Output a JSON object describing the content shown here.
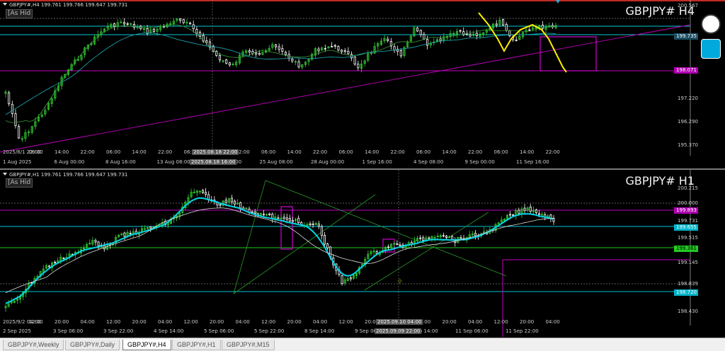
{
  "top": {
    "symbol_line": "GBPJPY#,H4  199.761 199.766 199.647 199.731",
    "as_hide": "[As Hid",
    "big_label": "GBPJPY#  H4",
    "price_labels": [
      "200.567",
      "198.150",
      "197.220",
      "196.290",
      "195.370"
    ],
    "tags": [
      {
        "text": "199.735",
        "bg": "#1b4f64",
        "fg": "#ffffff"
      },
      {
        "text": "198.071",
        "bg": "#b000b0",
        "fg": "#ffffff"
      }
    ],
    "time_labels": [
      "2025/8/1 22:00",
      "06:00",
      "14:00",
      "22:00",
      "06:00",
      "14:00",
      "22:00",
      "06:00",
      "14:00",
      "22:00",
      "06:00",
      "14:00",
      "22:00",
      "06:00",
      "14:00",
      "22:00",
      "06:00",
      "14:00",
      "22:00",
      "06:00",
      "14:00",
      "22:00"
    ],
    "time_labels_row2": [
      "1 Aug 2025",
      "6 Aug 00:00",
      "8 Aug 16:00",
      "13 Aug 08:00",
      "20 Aug 16:00",
      "25 Aug 08:00",
      "28 Aug 00:00",
      "1 Sep 16:00",
      "4 Sep 08:00",
      "9 Sep 00:00",
      "11 Sep 16:00"
    ],
    "crosshair_time_1": "2025.08.18 22:00",
    "crosshair_time_2": "2025.08.18 16:00"
  },
  "bottom": {
    "symbol_line": "GBPJPY#,H1  199.761 199.766 199.647 199.731",
    "as_hide": "[As Hid",
    "big_label": "GBPJPY#  H1",
    "price_labels": [
      "200.215",
      "200.000",
      "199.731",
      "199.515",
      "199.145",
      "198.839",
      "198.430"
    ],
    "tags": [
      {
        "text": "199.893",
        "bg": "#b000b0",
        "fg": "#ffffff"
      },
      {
        "text": "199.655",
        "bg": "#00b4c8",
        "fg": "#ffffff"
      },
      {
        "text": "199.361",
        "bg": "#22cc22",
        "fg": "#000000"
      },
      {
        "text": "198.720",
        "bg": "#00b4c8",
        "fg": "#ffffff"
      }
    ],
    "time_labels": [
      "2025/9/2 04:00",
      "12:00",
      "20:00",
      "04:00",
      "12:00",
      "20:00",
      "04:00",
      "12:00",
      "20:00",
      "04:00",
      "12:00",
      "20:00",
      "04:00",
      "12:00",
      "20:00",
      "04:00",
      "12:00",
      "20:00",
      "04:00",
      "12:00",
      "20:00",
      "04:00"
    ],
    "time_labels_row2": [
      "2 Sep 2025",
      "3 Sep 06:00",
      "3 Sep 22:00",
      "4 Sep 14:00",
      "5 Sep 06:00",
      "5 Sep 22:00",
      "8 Sep 14:00",
      "9 Sep 06:00",
      "10 Sep 14:00",
      "11 Sep 06:00",
      "11 Sep 22:00"
    ],
    "crosshair_time_1": "2025.09.10 04:00",
    "crosshair_time_2": "2025.09.09 22:00"
  },
  "tabs": [
    {
      "label": "GBPJPY#,Weekly",
      "active": false
    },
    {
      "label": "GBPJPY#,Daily",
      "active": false
    },
    {
      "label": "GBPJPY#,H4",
      "active": true
    },
    {
      "label": "GBPJPY#,H1",
      "active": false
    },
    {
      "label": "GBPJPY#,M15",
      "active": false
    }
  ],
  "colors": {
    "bull": "#32cd32",
    "bear": "#ffffff",
    "cyan": "#00d8e8",
    "magenta": "#d000d0",
    "yellow": "#ffee00"
  }
}
